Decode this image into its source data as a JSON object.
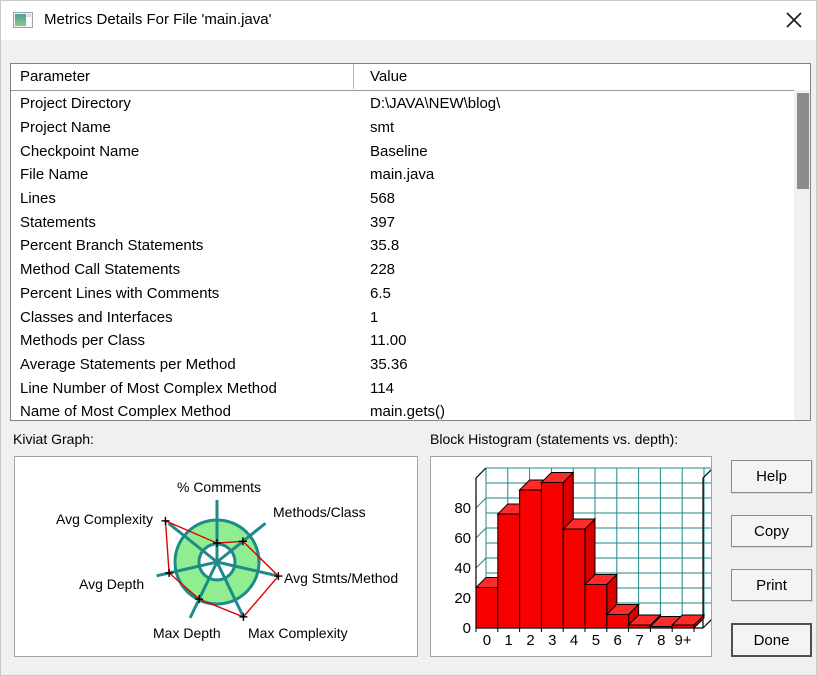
{
  "window": {
    "title": "Metrics Details For File 'main.java'",
    "close_icon": "✕"
  },
  "metrics_table": {
    "columns": [
      "Parameter",
      "Value"
    ],
    "rows": [
      [
        "Project Directory",
        "D:\\JAVA\\NEW\\blog\\"
      ],
      [
        "Project Name",
        "smt"
      ],
      [
        "Checkpoint Name",
        "Baseline"
      ],
      [
        "File Name",
        "main.java"
      ],
      [
        "Lines",
        "568"
      ],
      [
        "Statements",
        "397"
      ],
      [
        "Percent Branch Statements",
        "35.8"
      ],
      [
        "Method Call Statements",
        "228"
      ],
      [
        "Percent Lines with Comments",
        "6.5"
      ],
      [
        "Classes and Interfaces",
        "1"
      ],
      [
        "Methods per Class",
        "11.00"
      ],
      [
        "Average Statements per Method",
        "35.36"
      ],
      [
        "Line Number of Most Complex Method",
        "114"
      ],
      [
        "Name of Most Complex Method",
        "main.gets()"
      ]
    ]
  },
  "kiviat": {
    "label": "Kiviat Graph:",
    "colors": {
      "ring_fill": "#90ee90",
      "ring_stroke": "#1e8a8a",
      "data_line": "#e00000",
      "marker": "#000000"
    }
  },
  "histogram": {
    "label": "Block Histogram (statements vs. depth):",
    "colors": {
      "bar_front": "#f60000",
      "bar_side": "#d80000",
      "bar_top": "#ff2a2a",
      "grid": "#1e8a8a",
      "frame": "#000000"
    }
  },
  "buttons": {
    "help": "Help",
    "copy": "Copy",
    "print": "Print",
    "done": "Done"
  },
  "chart_data": [
    {
      "type": "radar",
      "title": "Kiviat Graph",
      "axes": [
        "% Comments",
        "Methods/Class",
        "Avg Stmts/Method",
        "Max Complexity",
        "Max Depth",
        "Avg Depth",
        "Avg Complexity"
      ],
      "angles_deg": [
        90,
        38.6,
        -12.9,
        -64.3,
        -115.7,
        -167.1,
        141.4
      ],
      "values_outer_ring_ratio": [
        0.45,
        0.79,
        1.5,
        1.45,
        0.98,
        1.17,
        1.57
      ],
      "ring": {
        "outer": 1.0,
        "inner": 0.43
      },
      "legend_position": "none"
    },
    {
      "type": "bar",
      "title": "Block Histogram (statements vs. depth)",
      "categories": [
        "0",
        "1",
        "2",
        "3",
        "4",
        "5",
        "6",
        "7",
        "8",
        "9+"
      ],
      "values": [
        27,
        76,
        92,
        97,
        66,
        29,
        9,
        2,
        1,
        2
      ],
      "xlabel": "depth",
      "ylabel": "statements",
      "ylim": [
        0,
        100
      ],
      "yticks": [
        0,
        20,
        40,
        60,
        80
      ],
      "grid_step": 10,
      "style": "3d-red-blocks"
    }
  ]
}
